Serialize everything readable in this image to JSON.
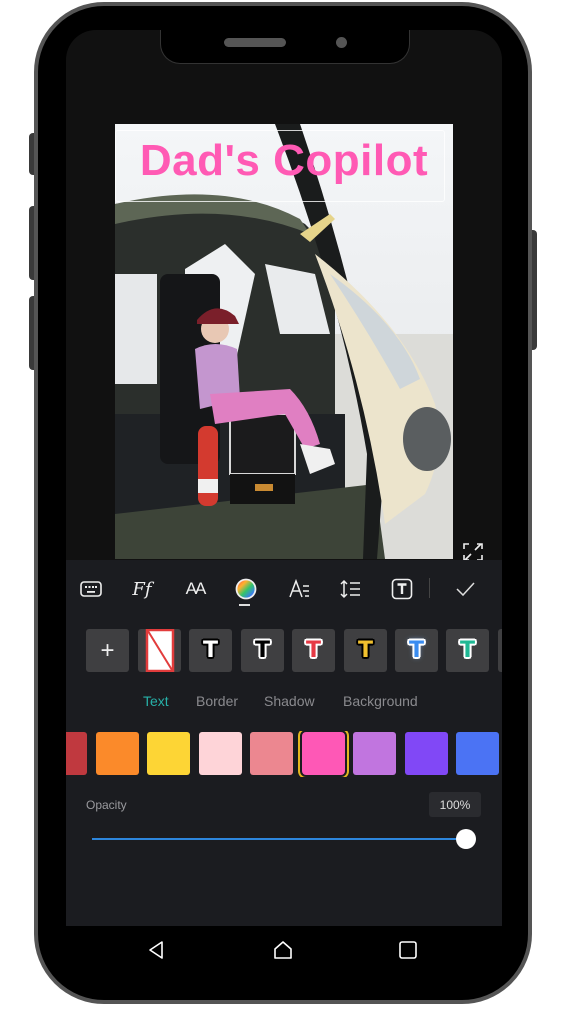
{
  "editor": {
    "overlay_text": "Dad's Copilot",
    "overlay_text_color": "#ff5ab4",
    "photo_alt": "Child in pink outfit and red cap wearing a headset, sitting in a helicopter cockpit"
  },
  "toolbar": {
    "items": [
      {
        "name": "keyboard",
        "icon": "keyboard-icon"
      },
      {
        "name": "font",
        "icon": "font-icon",
        "label": "Ff"
      },
      {
        "name": "text-size",
        "icon": "text-size-icon",
        "label": "AA"
      },
      {
        "name": "color",
        "icon": "color-wheel-icon",
        "active": true
      },
      {
        "name": "alignment",
        "icon": "text-align-icon"
      },
      {
        "name": "line-spacing",
        "icon": "line-spacing-icon"
      },
      {
        "name": "text-box",
        "icon": "text-box-icon",
        "label": "T"
      },
      {
        "name": "confirm",
        "icon": "checkmark-icon"
      }
    ]
  },
  "styles": {
    "add_label": "+",
    "presets": [
      {
        "name": "none",
        "fill": "#ffffff",
        "stroke": "#e23c3c"
      },
      {
        "name": "white-black-outline",
        "fill": "#ffffff",
        "stroke": "#000000"
      },
      {
        "name": "black-white-outline",
        "fill": "#000000",
        "stroke": "#ffffff"
      },
      {
        "name": "red-white-outline",
        "fill": "#e63a45",
        "stroke": "#ffffff"
      },
      {
        "name": "yellow-black-outline",
        "fill": "#f2c12e",
        "stroke": "#000000"
      },
      {
        "name": "blue-glow",
        "fill": "#3a8cf0",
        "stroke": "#ffffff"
      },
      {
        "name": "teal-white-outline",
        "fill": "#1fb894",
        "stroke": "#ffffff"
      }
    ],
    "preset_glyph": "T"
  },
  "subtabs": [
    {
      "label": "Text",
      "active": true
    },
    {
      "label": "Border",
      "active": false
    },
    {
      "label": "Shadow",
      "active": false
    },
    {
      "label": "Background",
      "active": false
    }
  ],
  "palette": {
    "colors": [
      "#c0393f",
      "#fb8a2a",
      "#fdd535",
      "#fed4d8",
      "#ec8790",
      "#fe58b6",
      "#c175df",
      "#8148f6",
      "#4b73f4"
    ],
    "selected_index": 5
  },
  "opacity": {
    "label": "Opacity",
    "value_text": "100%",
    "value": 1.0
  },
  "navbar": {
    "back": "back-icon",
    "home": "home-icon",
    "recents": "recents-icon"
  }
}
